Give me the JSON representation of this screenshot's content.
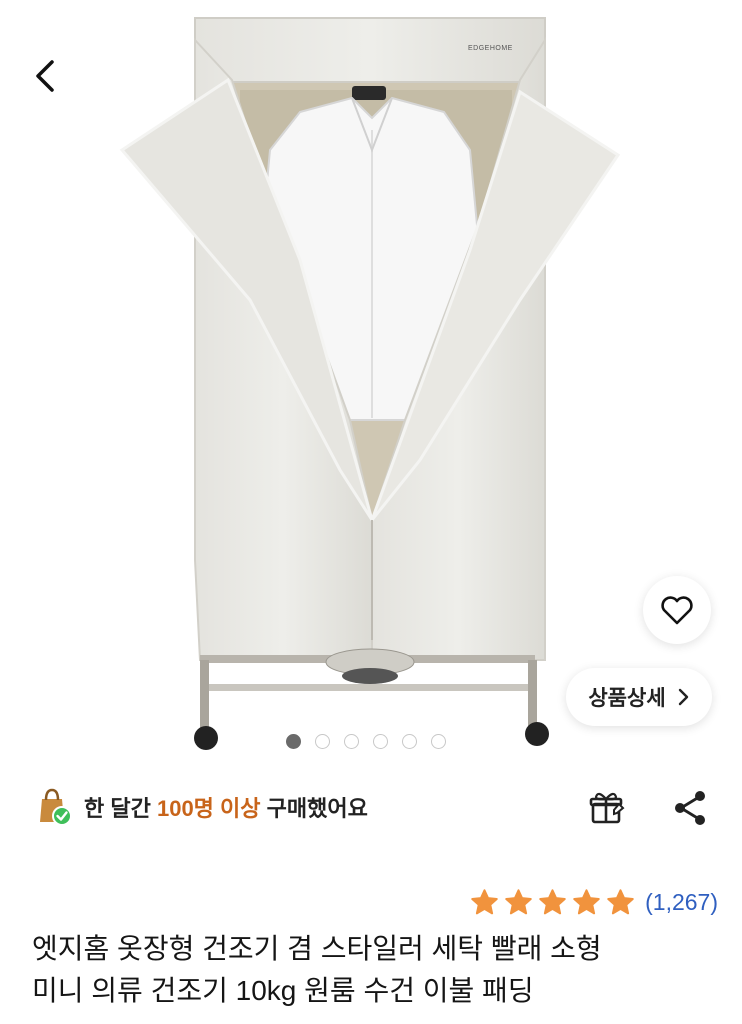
{
  "header": {
    "back_icon": "chevron-left-icon"
  },
  "image": {
    "brand_on_product": "EDGEHOME",
    "total_slides": 6,
    "active_slide": 1
  },
  "actions": {
    "wishlist_icon": "heart-outline-icon",
    "detail_button_label": "상품상세",
    "detail_chevron": "›"
  },
  "purchase": {
    "prefix": "한 달간",
    "highlight": "100명 이상",
    "suffix": "구매했어요",
    "icon": "shopping-bag-check-icon"
  },
  "tools": {
    "gift_icon": "gift-icon",
    "share_icon": "share-icon"
  },
  "rating": {
    "stars": 5,
    "review_count": "(1,267)"
  },
  "product": {
    "title_line1": "엣지홈 옷장형 건조기 겸 스타일러 세탁 빨래 소형",
    "title_line2": "미니 의류 건조기 10kg 원룸 수건 이불 패딩"
  },
  "colors": {
    "accent_orange": "#c8641a",
    "star": "#f1933d",
    "link_blue": "#2f5fc0"
  }
}
